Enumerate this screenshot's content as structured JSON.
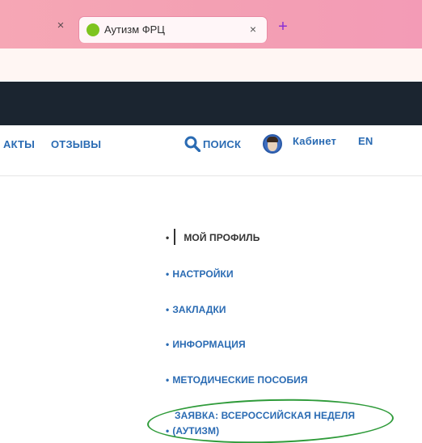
{
  "browser": {
    "active_tab": {
      "title": "Аутизм ФРЦ",
      "favicon_color": "#7ec41f"
    },
    "close_glyph": "×",
    "new_tab_glyph": "+"
  },
  "nav": {
    "contacts_fragment": "АКТЫ",
    "reviews": "ОТЗЫВЫ",
    "search": "ПОИСК",
    "cabinet": "Кабинет",
    "lang": "EN"
  },
  "menu": {
    "items": [
      {
        "label": "МОЙ ПРОФИЛЬ",
        "current": true
      },
      {
        "label": "НАСТРОЙКИ"
      },
      {
        "label": "ЗАКЛАДКИ"
      },
      {
        "label": "ИНФОРМАЦИЯ"
      },
      {
        "label": "МЕТОДИЧЕСКИЕ ПОСОБИЯ"
      },
      {
        "label_line1": "ЗАЯВКА: ВСЕРОССИЙСКАЯ НЕДЕЛЯ",
        "label_line2": "(АУТИЗМ)"
      }
    ],
    "bullet": "•"
  },
  "colors": {
    "link": "#2a6bb3",
    "site_band": "#1b2530",
    "highlight_circle": "#2f9b3a"
  }
}
